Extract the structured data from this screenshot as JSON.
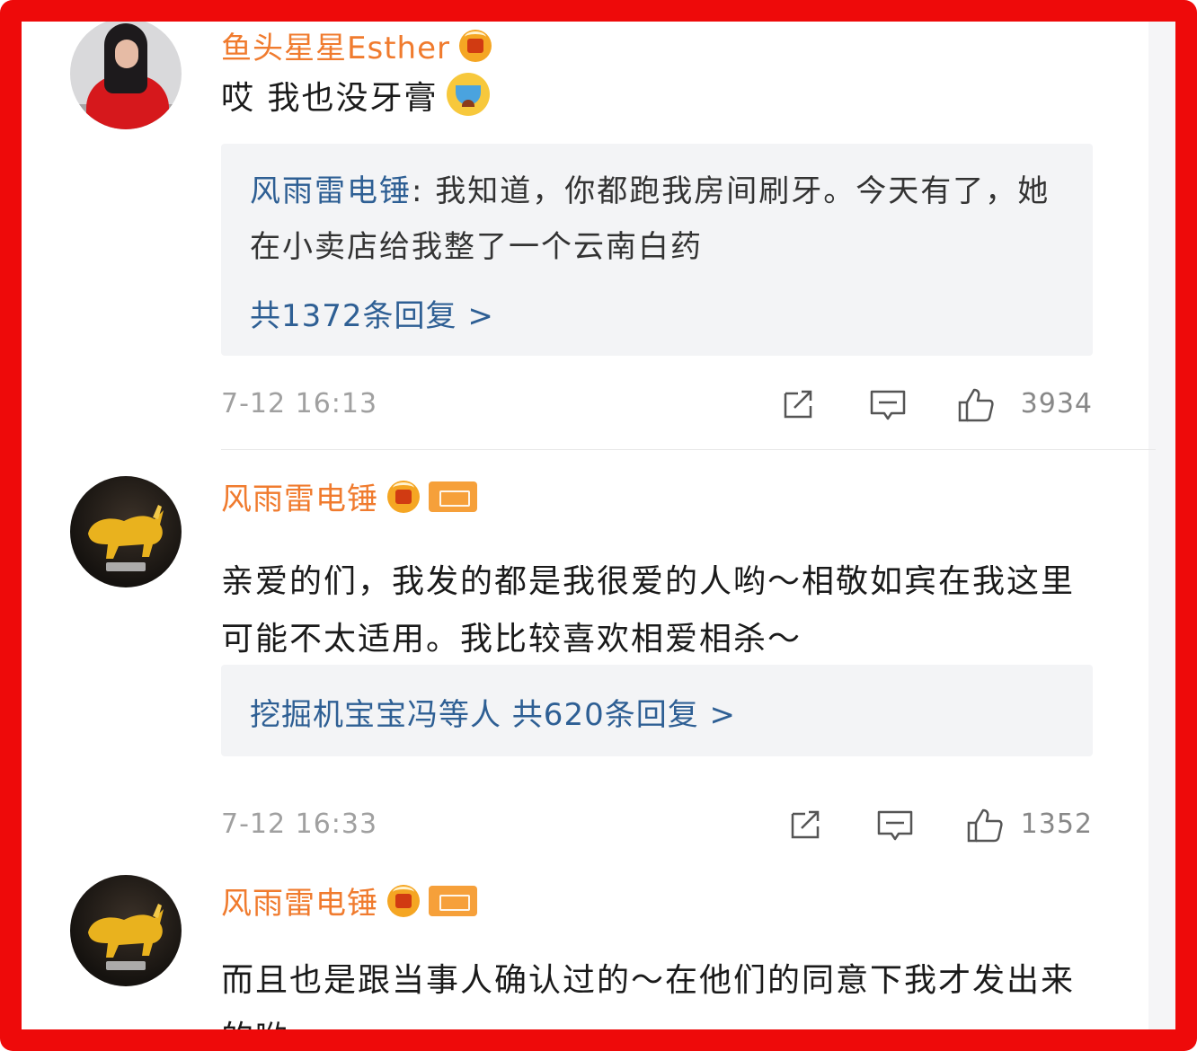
{
  "comments": [
    {
      "username": "鱼头星星Esther",
      "text": "哎 我也没牙膏",
      "emoji_icon": "crying-emoji",
      "reply_preview": {
        "user": "风雨雷电锤",
        "text": ": 我知道，你都跑我房间刷牙。今天有了，她在小卖店给我整了一个云南白药"
      },
      "reply_link": "共1372条回复 >",
      "timestamp": "7-12 16:13",
      "likes": "3934"
    },
    {
      "username": "风雨雷电锤",
      "text": "亲爱的们，我发的都是我很爱的人哟～相敬如宾在我这里可能不太适用。我比较喜欢相爱相杀～",
      "reply_link": "挖掘机宝宝冯等人  共620条回复 >",
      "timestamp": "7-12 16:33",
      "likes": "1352"
    },
    {
      "username": "风雨雷电锤",
      "text": "而且也是跟当事人确认过的～在他们的同意下我才发出来的哟～"
    }
  ],
  "colors": {
    "frame": "#ee0a0a",
    "username": "#f07b2e",
    "link": "#2e5f94",
    "reply_bg": "#f3f4f6",
    "meta": "#a0a0a0"
  },
  "icons": [
    "vip-badge-icon",
    "owner-badge-icon",
    "share-icon",
    "comment-icon",
    "like-icon"
  ]
}
